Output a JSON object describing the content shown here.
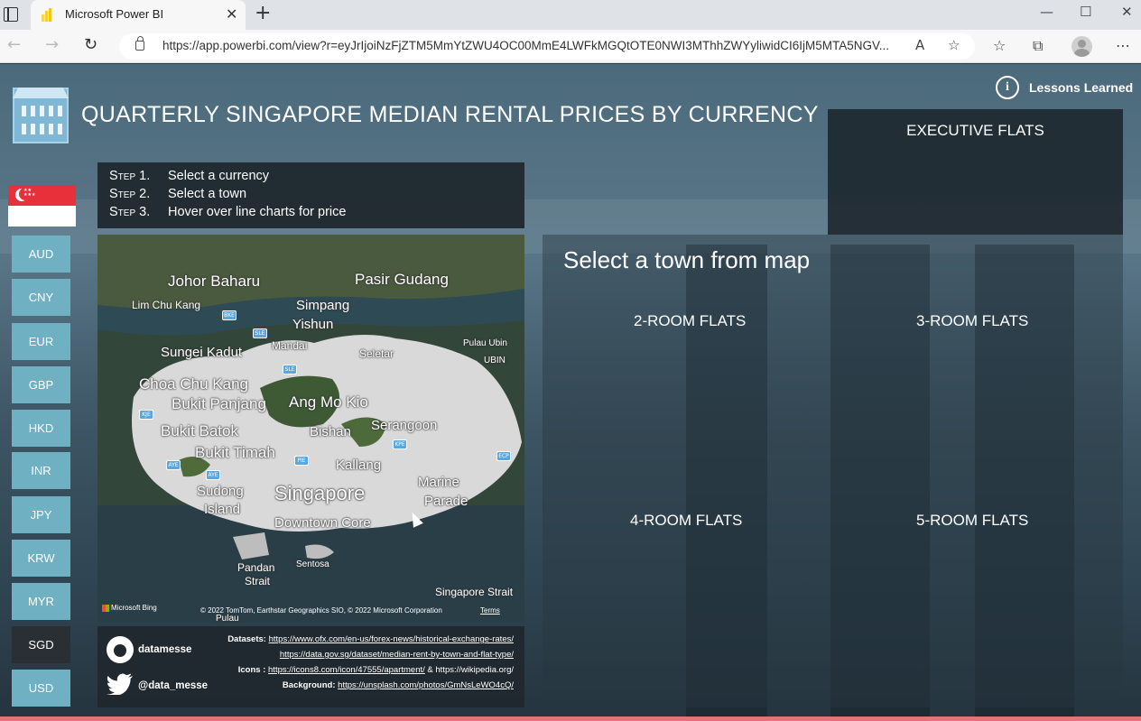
{
  "browser": {
    "tab_title": "Microsoft Power BI",
    "tab_close": "✕",
    "new_tab": "+",
    "url": "https://app.powerbi.com/view?r=eyJrIjoiNzFjZTM5MmYtZWU4OC00MmE4LWFkMGQtOTE0NWI3MThhZWYyliwidCI6IjM5MTA5NGV...",
    "window_controls": [
      "—",
      "☐",
      "✕"
    ]
  },
  "report": {
    "title": "QUARTERLY SINGAPORE MEDIAN RENTAL PRICES BY CURRENCY",
    "lessons_label": "Lessons Learned",
    "info_glyph": "i",
    "executive_label": "EXECUTIVE FLATS",
    "steps": [
      {
        "key": "Step 1.",
        "text": "Select a currency"
      },
      {
        "key": "Step 2.",
        "text": "Select a town"
      },
      {
        "key": "Step 3.",
        "text": "Hover over line charts for price"
      }
    ],
    "currencies": [
      "AUD",
      "CNY",
      "EUR",
      "GBP",
      "HKD",
      "INR",
      "JPY",
      "KRW",
      "MYR",
      "SGD",
      "USD"
    ],
    "selected_currency": "SGD",
    "town_prompt": "Select a town from map",
    "flat_types": [
      "2-ROOM FLATS",
      "3-ROOM FLATS",
      "4-ROOM FLATS",
      "5-ROOM FLATS"
    ],
    "map": {
      "places": [
        "Johor Baharu",
        "Pasir Gudang",
        "Lim Chu Kang",
        "Simpang",
        "Yishun",
        "Mandai",
        "Sungei Kadut",
        "Seletar",
        "Pulau Ubin",
        "UBIN",
        "Choa Chu Kang",
        "Bukit Panjang",
        "Ang Mo Kio",
        "Bishan",
        "Serangoon",
        "Bukit Batok",
        "Bukit Timah",
        "Kallang",
        "Marine",
        "Parade",
        "Sudong",
        "Island",
        "Singapore",
        "Downtown Core",
        "Pandan",
        "Strait",
        "Sentosa",
        "Singapore Strait",
        "Pulau"
      ],
      "highways": [
        "BKE",
        "SLE",
        "SLE",
        "KJE",
        "AYE",
        "PIE",
        "KPE",
        "ECP",
        "AYE"
      ],
      "provider": "Microsoft Bing",
      "copyright": "© 2022 TomTom, Earthstar Geographics SIO, © 2022 Microsoft Corporation",
      "terms": "Terms"
    },
    "credits": {
      "github": "datamesse",
      "twitter": "@data_messe",
      "datasets_label": "Datasets:",
      "dataset_url_1": "https://www.ofx.com/en-us/forex-news/historical-exchange-rates/",
      "dataset_url_2": "https://data.gov.sg/dataset/median-rent-by-town-and-flat-type/",
      "icons_label": "Icons :",
      "icons_url": "https://icons8.com/icon/47555/apartment/",
      "icons_amp": "&",
      "icons_url_2": "https://wikipedia.org/",
      "background_label": "Background:",
      "background_url": "https://unsplash.com/photos/GmNsLeWO4cQ/"
    }
  },
  "colors": {
    "currency_button": "#6fb0c2",
    "currency_active": "#2a2f33",
    "flag_red": "#e8303a"
  }
}
